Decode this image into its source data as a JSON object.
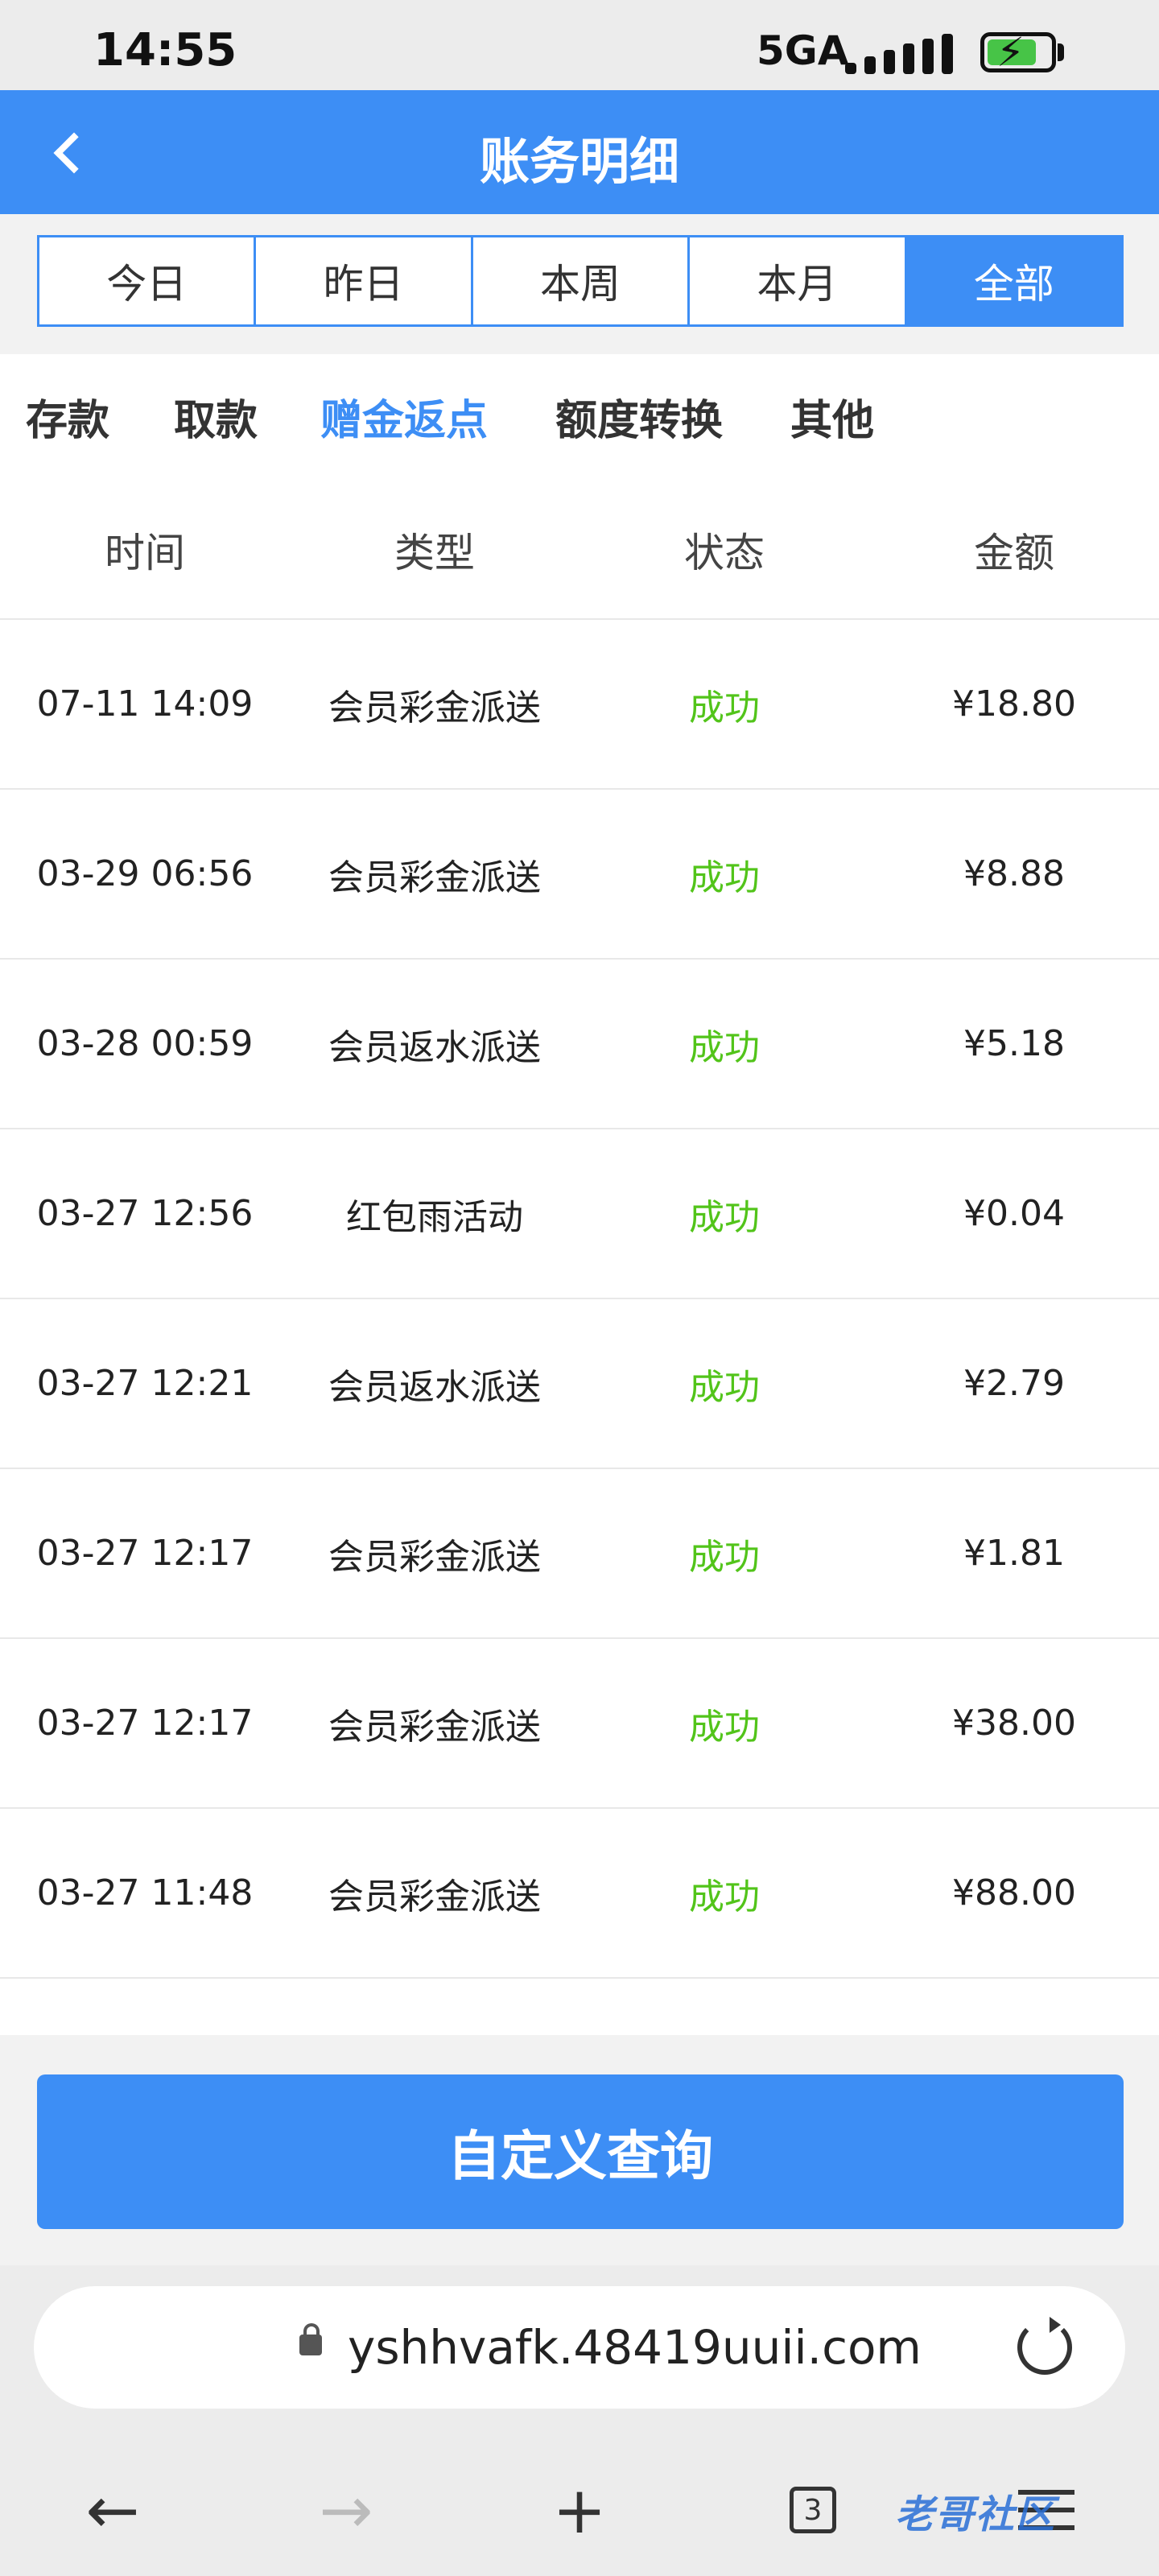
{
  "status_bar": {
    "time": "14:55",
    "network": "5GA"
  },
  "header": {
    "title": "账务明细"
  },
  "date_tabs": [
    {
      "label": "今日"
    },
    {
      "label": "昨日"
    },
    {
      "label": "本周"
    },
    {
      "label": "本月"
    },
    {
      "label": "全部",
      "active": true
    }
  ],
  "categories": [
    {
      "label": "存款"
    },
    {
      "label": "取款"
    },
    {
      "label": "赠金返点",
      "active": true
    },
    {
      "label": "额度转换"
    },
    {
      "label": "其他"
    }
  ],
  "table": {
    "headers": [
      "时间",
      "类型",
      "状态",
      "金额"
    ],
    "rows": [
      {
        "time": "07-11 14:09",
        "type": "会员彩金派送",
        "status": "成功",
        "amount": "¥18.80"
      },
      {
        "time": "03-29 06:56",
        "type": "会员彩金派送",
        "status": "成功",
        "amount": "¥8.88"
      },
      {
        "time": "03-28 00:59",
        "type": "会员返水派送",
        "status": "成功",
        "amount": "¥5.18"
      },
      {
        "time": "03-27 12:56",
        "type": "红包雨活动",
        "status": "成功",
        "amount": "¥0.04"
      },
      {
        "time": "03-27 12:21",
        "type": "会员返水派送",
        "status": "成功",
        "amount": "¥2.79"
      },
      {
        "time": "03-27 12:17",
        "type": "会员彩金派送",
        "status": "成功",
        "amount": "¥1.81"
      },
      {
        "time": "03-27 12:17",
        "type": "会员彩金派送",
        "status": "成功",
        "amount": "¥38.00"
      },
      {
        "time": "03-27 11:48",
        "type": "会员彩金派送",
        "status": "成功",
        "amount": "¥88.00"
      }
    ]
  },
  "query_button": {
    "label": "自定义查询"
  },
  "browser": {
    "url": "yshhvafk.48419uuii.com",
    "tab_count": "3",
    "watermark": "老哥社区"
  },
  "colors": {
    "accent": "#3d8ef5",
    "success": "#52c41a"
  }
}
